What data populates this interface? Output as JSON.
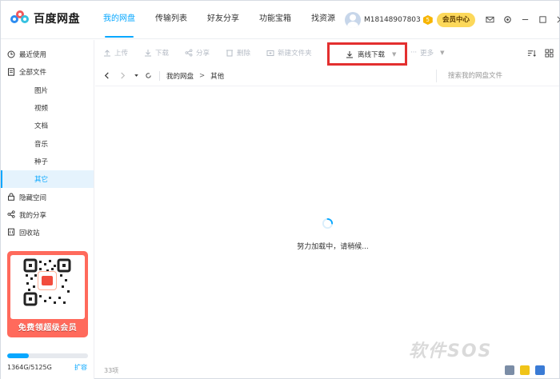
{
  "app": {
    "name": "百度网盘"
  },
  "nav": {
    "items": [
      {
        "label": "我的网盘",
        "active": true
      },
      {
        "label": "传输列表",
        "active": false
      },
      {
        "label": "好友分享",
        "active": false
      },
      {
        "label": "功能宝箱",
        "active": false
      },
      {
        "label": "找资源",
        "active": false
      }
    ]
  },
  "user": {
    "name": "M18148907803",
    "level": "5",
    "vip_label": "会员中心"
  },
  "top_icons": [
    "mail-icon",
    "settings-icon",
    "minimize-icon",
    "maximize-icon",
    "close-icon"
  ],
  "sidebar": {
    "items": [
      {
        "label": "最近使用",
        "icon": "clock-icon",
        "sub": false,
        "active": false
      },
      {
        "label": "全部文件",
        "icon": "file-icon",
        "sub": false,
        "active": false
      },
      {
        "label": "图片",
        "sub": true,
        "active": false
      },
      {
        "label": "视频",
        "sub": true,
        "active": false
      },
      {
        "label": "文档",
        "sub": true,
        "active": false
      },
      {
        "label": "音乐",
        "sub": true,
        "active": false
      },
      {
        "label": "种子",
        "sub": true,
        "active": false
      },
      {
        "label": "其它",
        "sub": true,
        "active": true
      },
      {
        "label": "隐藏空间",
        "icon": "lock-icon",
        "sub": false,
        "active": false
      },
      {
        "label": "我的分享",
        "icon": "share-icon",
        "sub": false,
        "active": false
      },
      {
        "label": "回收站",
        "icon": "trash-icon",
        "sub": false,
        "active": false
      }
    ],
    "promo_text": "免费领超级会员",
    "storage_text": "1364G/5125G",
    "storage_fraction": 0.266,
    "expand_label": "扩容"
  },
  "toolbar": {
    "upload": "上传",
    "download": "下载",
    "share": "分享",
    "delete": "删除",
    "new_folder": "新建文件夹",
    "offline_download": "离线下载",
    "more": "更多"
  },
  "address": {
    "crumbs": [
      "我的网盘",
      "其他"
    ],
    "search_placeholder": "搜索我的网盘文件"
  },
  "main": {
    "loading_text": "努力加载中，请稍候..."
  },
  "footer": {
    "count": "33项"
  },
  "watermark": "软件SOS",
  "colors": {
    "accent": "#06a7ff",
    "highlight_box": "#e32f2f",
    "vip": "#fcd85a",
    "promo": "#ff6a5c"
  }
}
